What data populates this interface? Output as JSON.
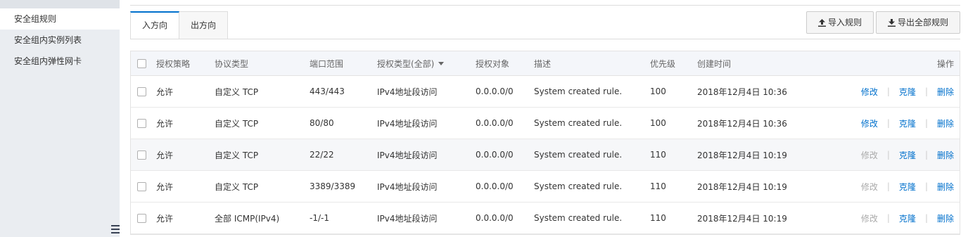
{
  "sidebar": {
    "items": [
      {
        "label": "安全组规则",
        "active": true
      },
      {
        "label": "安全组内实例列表",
        "active": false
      },
      {
        "label": "安全组内弹性网卡",
        "active": false
      }
    ],
    "collapse_icon": "menu-collapse-icon"
  },
  "tabs": [
    {
      "label": "入方向",
      "active": true
    },
    {
      "label": "出方向",
      "active": false
    }
  ],
  "toolbar": {
    "import_label": "导入规则",
    "export_label": "导出全部规则",
    "import_icon": "upload-icon",
    "export_icon": "download-icon"
  },
  "table": {
    "headers": {
      "auth": "授权策略",
      "proto": "协议类型",
      "port": "端口范围",
      "type": "授权类型(全部)",
      "target": "授权对象",
      "desc": "描述",
      "prio": "优先级",
      "time": "创建时间",
      "ops": "操作"
    },
    "ops": {
      "edit": "修改",
      "clone": "克隆",
      "delete": "删除",
      "separator": "|"
    },
    "rows": [
      {
        "auth": "允许",
        "proto": "自定义 TCP",
        "port": "443/443",
        "type": "IPv4地址段访问",
        "target": "0.0.0.0/0",
        "desc": "System created rule.",
        "prio": "100",
        "time": "2018年12月4日 10:36",
        "edit_enabled": true
      },
      {
        "auth": "允许",
        "proto": "自定义 TCP",
        "port": "80/80",
        "type": "IPv4地址段访问",
        "target": "0.0.0.0/0",
        "desc": "System created rule.",
        "prio": "100",
        "time": "2018年12月4日 10:36",
        "edit_enabled": true
      },
      {
        "auth": "允许",
        "proto": "自定义 TCP",
        "port": "22/22",
        "type": "IPv4地址段访问",
        "target": "0.0.0.0/0",
        "desc": "System created rule.",
        "prio": "110",
        "time": "2018年12月4日 10:19",
        "edit_enabled": false
      },
      {
        "auth": "允许",
        "proto": "自定义 TCP",
        "port": "3389/3389",
        "type": "IPv4地址段访问",
        "target": "0.0.0.0/0",
        "desc": "System created rule.",
        "prio": "110",
        "time": "2018年12月4日 10:19",
        "edit_enabled": false
      },
      {
        "auth": "允许",
        "proto": "全部 ICMP(IPv4)",
        "port": "-1/-1",
        "type": "IPv4地址段访问",
        "target": "0.0.0.0/0",
        "desc": "System created rule.",
        "prio": "110",
        "time": "2018年12月4日 10:19",
        "edit_enabled": false
      }
    ]
  }
}
